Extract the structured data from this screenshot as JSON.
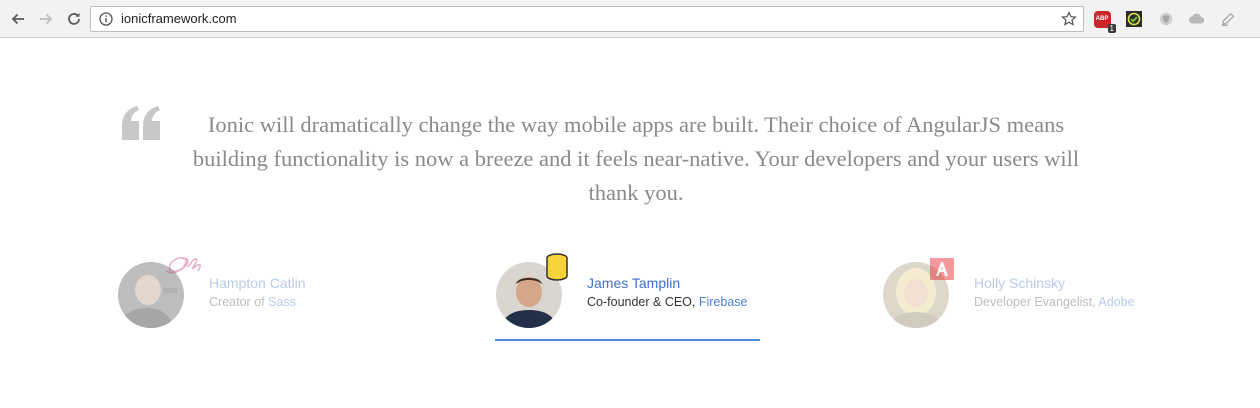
{
  "browser": {
    "url": "ionicframework.com",
    "extensions": [
      {
        "icon": "adblock-plus-icon",
        "label": "ABP",
        "badge": "1"
      },
      {
        "icon": "checkmark-extension-icon"
      },
      {
        "icon": "shield-extension-icon"
      },
      {
        "icon": "cloud-extension-icon"
      },
      {
        "icon": "pen-extension-icon"
      }
    ]
  },
  "quote": {
    "text": "Ionic will dramatically change the way mobile apps are built. Their choice of AngularJS means building functionality is now a breeze and it feels near-native. Your developers and your users will thank you."
  },
  "testimonials": [
    {
      "name": "Hampton Catlin",
      "role_prefix": "Creator of ",
      "company": "Sass",
      "badge": "sass-logo-icon",
      "active": false
    },
    {
      "name": "James Tamplin",
      "role_prefix": "Co-founder & CEO, ",
      "company": "Firebase",
      "badge": "firebase-database-icon",
      "active": true
    },
    {
      "name": "Holly Schinsky",
      "role_prefix": "Developer Evangelist, ",
      "company": "Adobe",
      "badge": "adobe-logo-icon",
      "active": false
    }
  ],
  "colors": {
    "accent": "#4a8fd8",
    "quote_text": "#8a8a8a",
    "quote_mark": "#c8c8c8"
  }
}
